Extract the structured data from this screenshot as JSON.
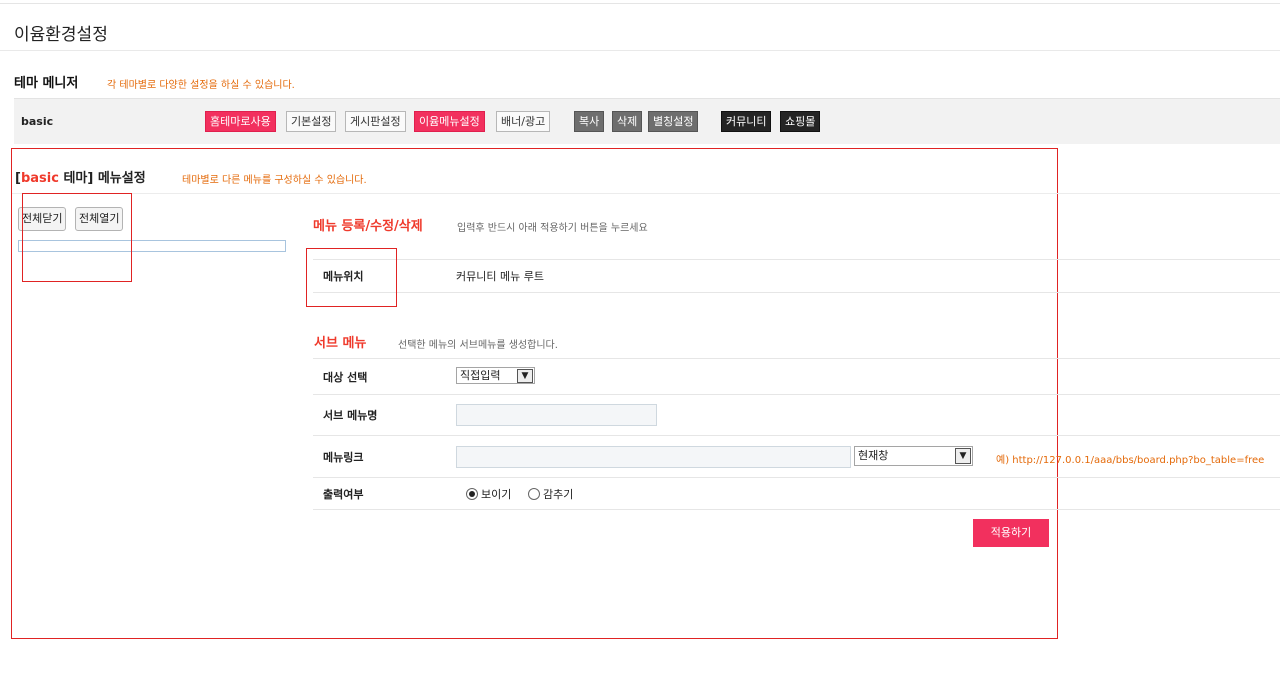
{
  "page": {
    "title": "이윰환경설정"
  },
  "manager": {
    "heading": "테마 메니저",
    "description": "각 테마별로 다양한 설정을 하실 수 있습니다.",
    "theme_name": "basic",
    "buttons": {
      "home_theme": "홈테마로사용",
      "basic_settings": "기본설정",
      "board_settings": "게시판설정",
      "menu_settings": "이윰메뉴설정",
      "banner_ad": "배너/광고",
      "copy": "복사",
      "delete": "삭제",
      "alias_settings": "별칭설정",
      "community": "커뮤니티",
      "shopping_mall": "쇼핑몰"
    }
  },
  "menu_settings": {
    "heading_bracket_open": "[",
    "heading_theme": "basic",
    "heading_rest": " 테마] 메뉴설정",
    "description": "테마별로 다른 메뉴를 구성하실 수 있습니다.",
    "collapse_all": "전체닫기",
    "expand_all": "전체열기"
  },
  "register": {
    "title": "메뉴 등록/수정/삭제",
    "description": "입력후 반드시 아래 적용하기 버튼을 누르세요",
    "position_label": "메뉴위치",
    "position_value": "커뮤니티 메뉴 루트"
  },
  "submenu": {
    "title": "서브 메뉴",
    "description": "선택한 메뉴의 서브메뉴를 생성합니다.",
    "target_label": "대상 선택",
    "target_value": "직접입력",
    "name_label": "서브 메뉴명",
    "name_value": "",
    "link_label": "메뉴링크",
    "link_value": "",
    "link_target_value": "현재창",
    "link_hint": "예) http://127.0.0.1/aaa/bbs/board.php?bo_table=free",
    "display_label": "출력여부",
    "show_label": "보이기",
    "hide_label": "감추기",
    "display_selected": "보이기"
  },
  "apply_button": "적용하기",
  "colors": {
    "accent_pink": "#f2305e",
    "accent_orange": "#e46a0a",
    "accent_red": "#ef3a2c",
    "highlight_box": "#e02323"
  }
}
